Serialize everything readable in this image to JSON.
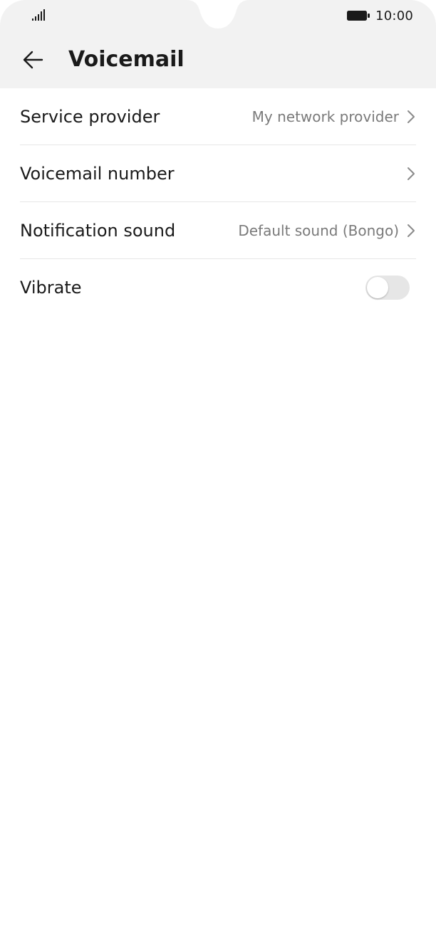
{
  "status_bar": {
    "time": "10:00",
    "signal_icon": "signal-bars-icon",
    "battery_icon": "battery-full-icon"
  },
  "app_bar": {
    "back_icon": "arrow-left-icon",
    "title": "Voicemail"
  },
  "settings": {
    "rows": [
      {
        "label": "Service provider",
        "value": "My network provider",
        "icon": "chevron-right-icon"
      },
      {
        "label": "Voicemail number",
        "value": "",
        "icon": "chevron-right-icon"
      },
      {
        "label": "Notification sound",
        "value": "Default sound (Bongo)",
        "icon": "chevron-right-icon"
      },
      {
        "label": "Vibrate",
        "toggle_on": false
      }
    ]
  },
  "colors": {
    "header_background": "#f2f2f2",
    "page_background": "#ffffff",
    "divider": "#e6e6e6",
    "secondary_text": "#7a7a7a",
    "toggle_off_track": "#e6e6e6"
  }
}
